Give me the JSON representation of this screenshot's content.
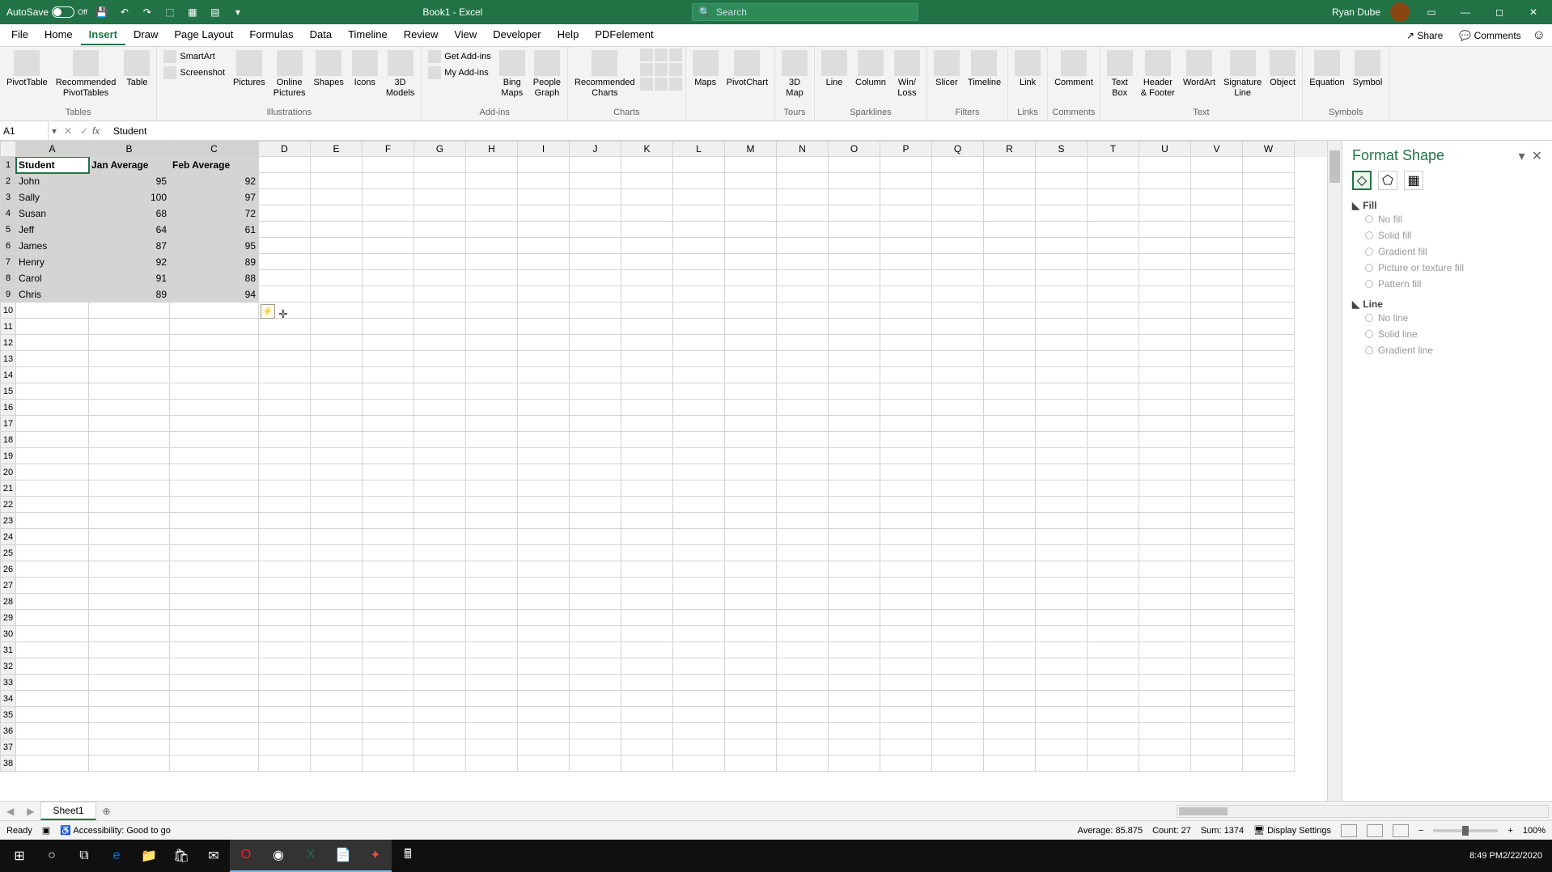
{
  "titlebar": {
    "autosave_label": "AutoSave",
    "autosave_state": "Off",
    "doc_title": "Book1 - Excel",
    "search_placeholder": "Search",
    "username": "Ryan Dube"
  },
  "tabs": {
    "items": [
      "File",
      "Home",
      "Insert",
      "Draw",
      "Page Layout",
      "Formulas",
      "Data",
      "Timeline",
      "Review",
      "View",
      "Developer",
      "Help",
      "PDFelement"
    ],
    "active_index": 2,
    "share": "Share",
    "comments": "Comments"
  },
  "ribbon": {
    "groups": [
      {
        "label": "Tables",
        "buttons": [
          "PivotTable",
          "Recommended\nPivotTables",
          "Table"
        ]
      },
      {
        "label": "Illustrations",
        "buttons": [
          "Pictures",
          "Online\nPictures",
          "Shapes",
          "Icons",
          "3D\nModels"
        ],
        "small": [
          "SmartArt",
          "Screenshot"
        ]
      },
      {
        "label": "Add-ins",
        "buttons": [
          "Bing\nMaps",
          "People\nGraph"
        ],
        "small": [
          "Get Add-ins",
          "My Add-ins"
        ]
      },
      {
        "label": "Charts",
        "buttons": [
          "Recommended\nCharts"
        ],
        "small_grid": true
      },
      {
        "label": "",
        "buttons": [
          "Maps",
          "PivotChart"
        ]
      },
      {
        "label": "Tours",
        "buttons": [
          "3D\nMap"
        ]
      },
      {
        "label": "Sparklines",
        "buttons": [
          "Line",
          "Column",
          "Win/\nLoss"
        ]
      },
      {
        "label": "Filters",
        "buttons": [
          "Slicer",
          "Timeline"
        ]
      },
      {
        "label": "Links",
        "buttons": [
          "Link"
        ]
      },
      {
        "label": "Comments",
        "buttons": [
          "Comment"
        ]
      },
      {
        "label": "Text",
        "buttons": [
          "Text\nBox",
          "Header\n& Footer",
          "WordArt",
          "Signature\nLine",
          "Object"
        ]
      },
      {
        "label": "Symbols",
        "buttons": [
          "Equation",
          "Symbol"
        ]
      }
    ]
  },
  "formula_bar": {
    "name_box": "A1",
    "formula": "Student"
  },
  "grid": {
    "columns": [
      "A",
      "B",
      "C",
      "D",
      "E",
      "F",
      "G",
      "H",
      "I",
      "J",
      "K",
      "L",
      "M",
      "N",
      "O",
      "P",
      "Q",
      "R",
      "S",
      "T",
      "U",
      "V",
      "W"
    ],
    "col_widths": {
      "A": 90,
      "B": 100,
      "C": 110,
      "default": 64
    },
    "selected_cols": [
      0,
      1,
      2
    ],
    "selected_rows": [
      1,
      2,
      3,
      4,
      5,
      6,
      7,
      8,
      9
    ],
    "active_cell": "A1",
    "data": [
      {
        "r": 1,
        "c": 0,
        "v": "Student",
        "bold": true
      },
      {
        "r": 1,
        "c": 1,
        "v": "Jan Average",
        "bold": true
      },
      {
        "r": 1,
        "c": 2,
        "v": "Feb Average",
        "bold": true
      },
      {
        "r": 2,
        "c": 0,
        "v": "John"
      },
      {
        "r": 2,
        "c": 1,
        "v": "95",
        "num": true
      },
      {
        "r": 2,
        "c": 2,
        "v": "92",
        "num": true
      },
      {
        "r": 3,
        "c": 0,
        "v": "Sally"
      },
      {
        "r": 3,
        "c": 1,
        "v": "100",
        "num": true
      },
      {
        "r": 3,
        "c": 2,
        "v": "97",
        "num": true
      },
      {
        "r": 4,
        "c": 0,
        "v": "Susan"
      },
      {
        "r": 4,
        "c": 1,
        "v": "68",
        "num": true
      },
      {
        "r": 4,
        "c": 2,
        "v": "72",
        "num": true
      },
      {
        "r": 5,
        "c": 0,
        "v": "Jeff"
      },
      {
        "r": 5,
        "c": 1,
        "v": "64",
        "num": true
      },
      {
        "r": 5,
        "c": 2,
        "v": "61",
        "num": true
      },
      {
        "r": 6,
        "c": 0,
        "v": "James"
      },
      {
        "r": 6,
        "c": 1,
        "v": "87",
        "num": true
      },
      {
        "r": 6,
        "c": 2,
        "v": "95",
        "num": true
      },
      {
        "r": 7,
        "c": 0,
        "v": "Henry"
      },
      {
        "r": 7,
        "c": 1,
        "v": "92",
        "num": true
      },
      {
        "r": 7,
        "c": 2,
        "v": "89",
        "num": true
      },
      {
        "r": 8,
        "c": 0,
        "v": "Carol"
      },
      {
        "r": 8,
        "c": 1,
        "v": "91",
        "num": true
      },
      {
        "r": 8,
        "c": 2,
        "v": "88",
        "num": true
      },
      {
        "r": 9,
        "c": 0,
        "v": "Chris"
      },
      {
        "r": 9,
        "c": 1,
        "v": "89",
        "num": true
      },
      {
        "r": 9,
        "c": 2,
        "v": "94",
        "num": true
      }
    ],
    "row_count": 38
  },
  "pane": {
    "title": "Format Shape",
    "sections": {
      "fill": {
        "label": "Fill",
        "options": [
          "No fill",
          "Solid fill",
          "Gradient fill",
          "Picture or texture fill",
          "Pattern fill"
        ]
      },
      "line": {
        "label": "Line",
        "options": [
          "No line",
          "Solid line",
          "Gradient line"
        ]
      }
    }
  },
  "sheet_tabs": {
    "active": "Sheet1"
  },
  "status_bar": {
    "ready": "Ready",
    "accessibility": "Accessibility: Good to go",
    "average_label": "Average:",
    "average_value": "85.875",
    "count_label": "Count:",
    "count_value": "27",
    "sum_label": "Sum:",
    "sum_value": "1374",
    "display_settings": "Display Settings",
    "zoom": "100%"
  },
  "taskbar": {
    "time": "8:49 PM",
    "date": "2/22/2020"
  }
}
